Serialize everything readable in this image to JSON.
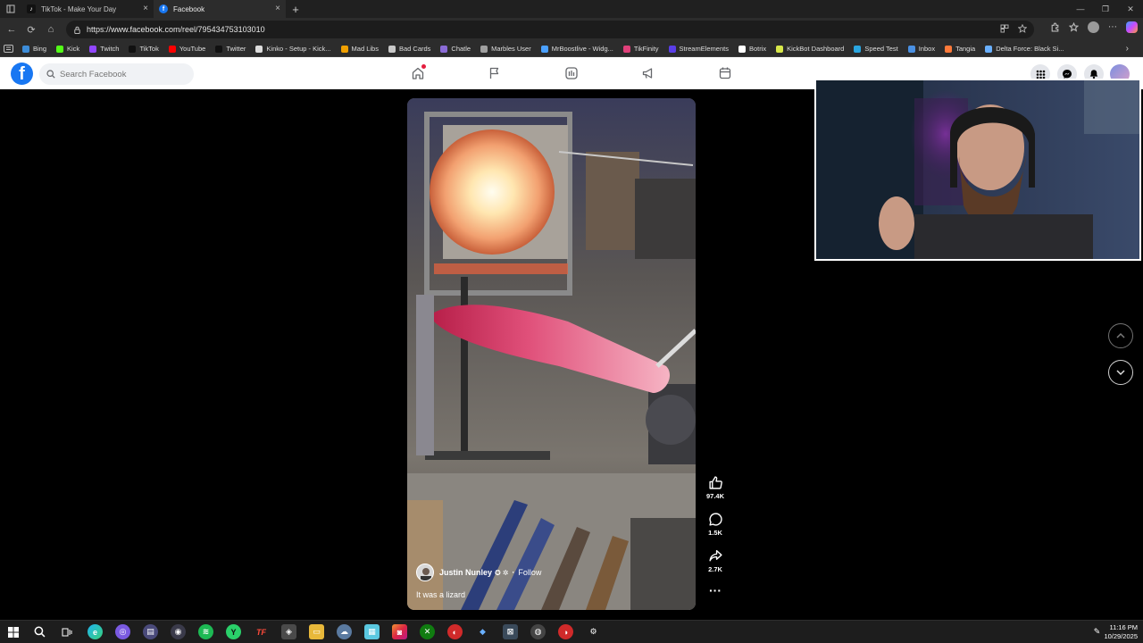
{
  "browser": {
    "tabs": [
      {
        "title": "TikTok - Make Your Day",
        "active": false
      },
      {
        "title": "Facebook",
        "active": true
      }
    ],
    "url": "https://www.facebook.com/reel/795434753103010",
    "bookmarks": [
      {
        "label": "Bing",
        "color": "#3c8cd8"
      },
      {
        "label": "Kick",
        "color": "#53fc18"
      },
      {
        "label": "Twitch",
        "color": "#9146ff"
      },
      {
        "label": "TikTok",
        "color": "#111111"
      },
      {
        "label": "YouTube",
        "color": "#ff0000"
      },
      {
        "label": "Twitter",
        "color": "#111111"
      },
      {
        "label": "Kinko - Setup - Kick...",
        "color": "#dddddd"
      },
      {
        "label": "Mad Libs",
        "color": "#f0a000"
      },
      {
        "label": "Bad Cards",
        "color": "#c8c8c8"
      },
      {
        "label": "Chatle",
        "color": "#8a6bd6"
      },
      {
        "label": "Marbles User",
        "color": "#a0a0a0"
      },
      {
        "label": "MrBoostlive - Widg...",
        "color": "#4aa0ff"
      },
      {
        "label": "TikFinity",
        "color": "#e0407a"
      },
      {
        "label": "StreamElements",
        "color": "#5a3ee8"
      },
      {
        "label": "Botrix",
        "color": "#ffffff"
      },
      {
        "label": "KickBot Dashboard",
        "color": "#d8e84a"
      },
      {
        "label": "Speed Test",
        "color": "#2aa6e0"
      },
      {
        "label": "Inbox",
        "color": "#4a90e2"
      },
      {
        "label": "Tangia",
        "color": "#ff7a3a"
      },
      {
        "label": "Delta Force: Black Si...",
        "color": "#6ab0ff"
      }
    ]
  },
  "facebook": {
    "logo": "f",
    "search_placeholder": "Search Facebook",
    "nav": [
      "home-icon",
      "flag-icon",
      "video-icon",
      "megaphone-icon",
      "calendar-icon"
    ]
  },
  "reel": {
    "author": "Justin Nunley",
    "follow": "Follow",
    "caption": "It was a lizard",
    "likes": "97.4K",
    "comments": "1.5K",
    "shares": "2.7K"
  },
  "taskbar": {
    "time": "11:16 PM",
    "date": "10/29/2025"
  },
  "colors": {
    "facebook_blue": "#1877f2",
    "browser_dark": "#202020"
  }
}
